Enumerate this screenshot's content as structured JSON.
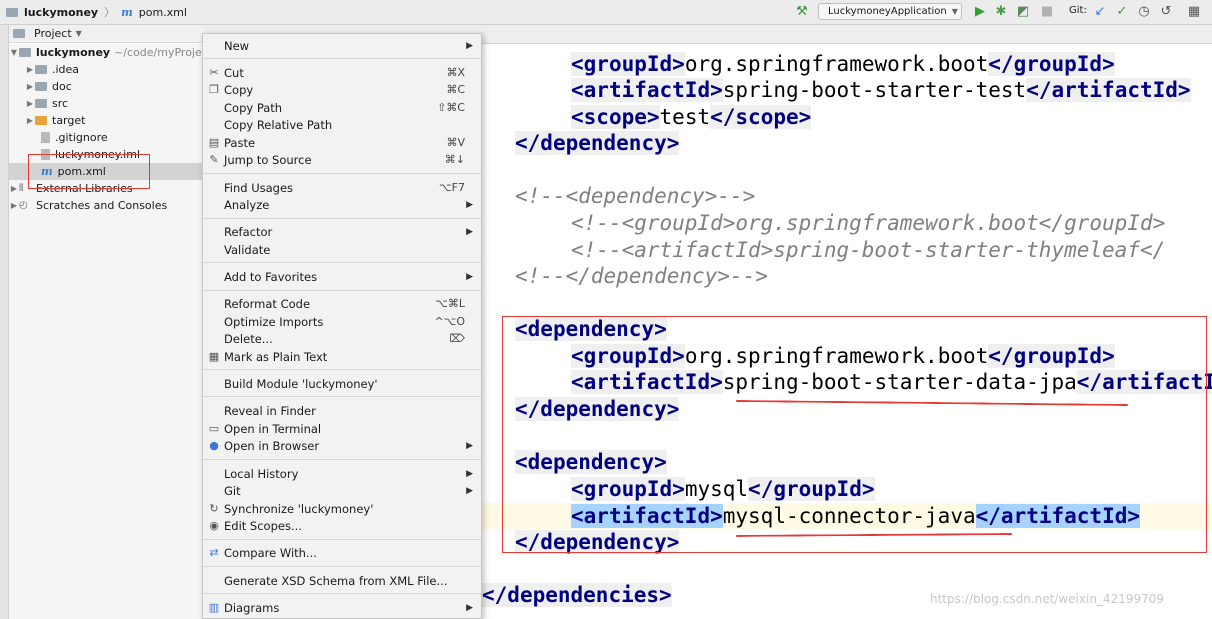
{
  "breadcrumb": {
    "project": "luckymoney",
    "file": "pom.xml"
  },
  "toolbar": {
    "run_config": "LuckymoneyApplication",
    "git_label": "Git:"
  },
  "project_panel": {
    "title": "Project",
    "root": {
      "name": "luckymoney",
      "path": "~/code/myProje"
    },
    "items": [
      {
        "name": ".idea"
      },
      {
        "name": "doc"
      },
      {
        "name": "src"
      },
      {
        "name": "target"
      },
      {
        "name": ".gitignore"
      },
      {
        "name": "luckymoney.iml"
      },
      {
        "name": "pom.xml"
      },
      {
        "name": "External Libraries"
      },
      {
        "name": "Scratches and Consoles"
      }
    ]
  },
  "context_menu": {
    "items": [
      {
        "label": "New",
        "shortcut": ""
      },
      {
        "label": "Cut",
        "shortcut": "⌘X"
      },
      {
        "label": "Copy",
        "shortcut": "⌘C"
      },
      {
        "label": "Copy Path",
        "shortcut": "⇧⌘C"
      },
      {
        "label": "Copy Relative Path",
        "shortcut": ""
      },
      {
        "label": "Paste",
        "shortcut": "⌘V"
      },
      {
        "label": "Jump to Source",
        "shortcut": "⌘↓"
      },
      {
        "label": "Find Usages",
        "shortcut": "⌥F7"
      },
      {
        "label": "Analyze",
        "shortcut": ""
      },
      {
        "label": "Refactor",
        "shortcut": ""
      },
      {
        "label": "Validate",
        "shortcut": ""
      },
      {
        "label": "Add to Favorites",
        "shortcut": ""
      },
      {
        "label": "Reformat Code",
        "shortcut": "⌥⌘L"
      },
      {
        "label": "Optimize Imports",
        "shortcut": "^⌥O"
      },
      {
        "label": "Delete...",
        "shortcut": "⌦"
      },
      {
        "label": "Mark as Plain Text",
        "shortcut": ""
      },
      {
        "label": "Build Module 'luckymoney'",
        "shortcut": ""
      },
      {
        "label": "Reveal in Finder",
        "shortcut": ""
      },
      {
        "label": "Open in Terminal",
        "shortcut": ""
      },
      {
        "label": "Open in Browser",
        "shortcut": ""
      },
      {
        "label": "Local History",
        "shortcut": ""
      },
      {
        "label": "Git",
        "shortcut": ""
      },
      {
        "label": "Synchronize 'luckymoney'",
        "shortcut": ""
      },
      {
        "label": "Edit Scopes...",
        "shortcut": ""
      },
      {
        "label": "Compare With...",
        "shortcut": ""
      },
      {
        "label": "Generate XSD Schema from XML File...",
        "shortcut": ""
      },
      {
        "label": "Diagrams",
        "shortcut": ""
      }
    ]
  },
  "editor": {
    "groupId_boot": "org.springframework.boot",
    "artifact_test": "spring-boot-starter-test",
    "scope": "test",
    "comment_1": "<!--<dependency>-->",
    "comment_2": "<!--<groupId>org.springframework.boot</groupId>",
    "comment_3": "<!--<artifactId>spring-boot-starter-thymeleaf</",
    "comment_4": "<!--</dependency>-->",
    "artifact_jpa": "spring-boot-starter-data-jpa",
    "groupId_mysql": "mysql",
    "artifact_mysql": "mysql-connector-java",
    "tag_groupId": "groupId",
    "tag_artifactId": "artifactId",
    "tag_scope": "scope",
    "tag_dependency": "dependency",
    "tag_dependencies": "dependencies"
  },
  "watermark": "https://blog.csdn.net/weixin_42199709",
  "colors": {
    "annotation_red": "#e53935",
    "selection": "#a6d2ff",
    "tag": "#000080"
  }
}
